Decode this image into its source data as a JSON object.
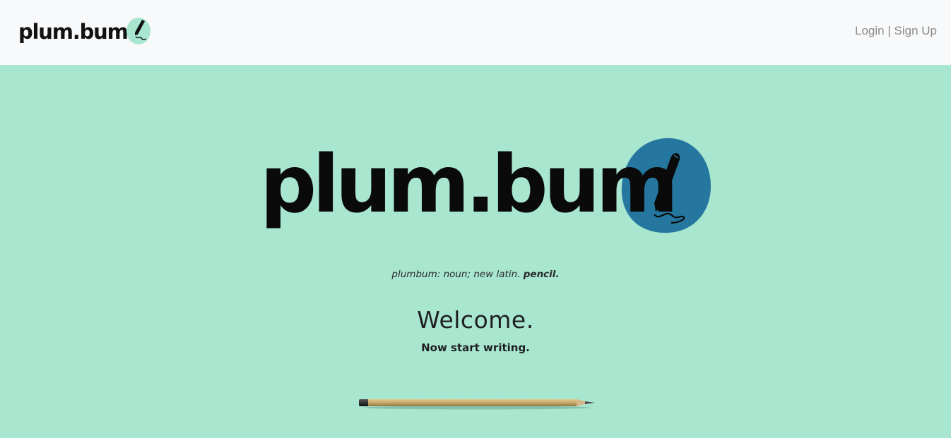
{
  "navbar": {
    "brand": "plum.bum",
    "login_label": "Login",
    "separator": "|",
    "signup_label": "Sign Up"
  },
  "hero": {
    "logo_text": "plum.bum",
    "definition_prefix": "plumbum: noun; new latin.",
    "definition_word": "pencil.",
    "welcome": "Welcome.",
    "subtitle": "Now start writing."
  },
  "colors": {
    "page_background": "#a8e6cf",
    "navbar_background": "#f8f9fa",
    "logo_small_circle": "#a8e6cf",
    "logo_large_circle": "#2577a0",
    "nav_link": "#8a8a8a"
  },
  "icons": {
    "nav_logo_mark": "pen-icon",
    "hero_logo_mark": "pen-icon",
    "decoration": "pencil-icon"
  }
}
